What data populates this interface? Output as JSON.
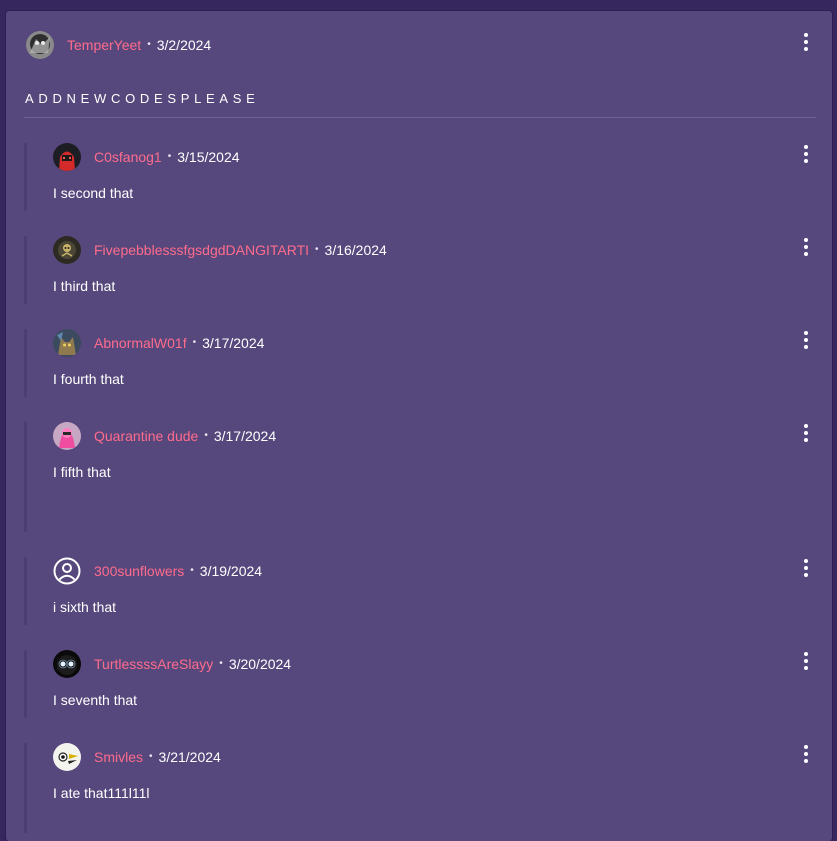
{
  "post": {
    "username": "TemperYeet",
    "separator": "•",
    "date": "3/2/2024",
    "body": "ADDNEWCODESPLEASE"
  },
  "replies": [
    {
      "username": "C0sfanog1",
      "date": "3/15/2024",
      "body": "I second that",
      "avatar_icon": "red-hooded-avatar-icon"
    },
    {
      "username": "FivepebblesssfgsdgdDANGITARTI",
      "date": "3/16/2024",
      "body": "I third that",
      "avatar_icon": "dark-creature-avatar-icon"
    },
    {
      "username": "AbnormalW01f",
      "date": "3/17/2024",
      "body": "I fourth that",
      "avatar_icon": "wolf-avatar-icon"
    },
    {
      "username": "Quarantine dude",
      "date": "3/17/2024",
      "body": "I fifth that",
      "avatar_icon": "pink-character-avatar-icon"
    },
    {
      "username": "300sunflowers",
      "date": "3/19/2024",
      "body": "i sixth that",
      "avatar_icon": "default-user-icon"
    },
    {
      "username": "TurtlessssAreSlayy",
      "date": "3/20/2024",
      "body": "I seventh that",
      "avatar_icon": "glowing-eyes-avatar-icon"
    },
    {
      "username": "Smivles",
      "date": "3/21/2024",
      "body": "I ate that111l11l",
      "avatar_icon": "bird-avatar-icon"
    }
  ],
  "colors": {
    "page_background": "#37275f",
    "card_background": "#56487c",
    "username": "#ff6b8d",
    "text": "#ffffff"
  },
  "icons": {
    "more_menu": "kebab-menu-icon"
  }
}
